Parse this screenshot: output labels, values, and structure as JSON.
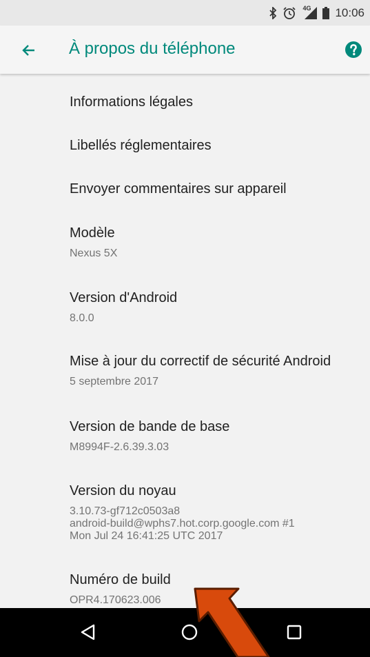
{
  "status_bar": {
    "network_label": "4G",
    "time": "10:06",
    "icons": [
      "bluetooth-icon",
      "alarm-icon",
      "signal-icon",
      "battery-icon"
    ]
  },
  "app_bar": {
    "title": "À propos du téléphone",
    "accent_color": "#00897b",
    "back_icon": "arrow-back-icon",
    "help_icon": "help-circle-icon"
  },
  "preferences": [
    {
      "title": "Informations légales"
    },
    {
      "title": "Libellés réglementaires"
    },
    {
      "title": "Envoyer commentaires sur appareil"
    },
    {
      "title": "Modèle",
      "summary": [
        "Nexus 5X"
      ]
    },
    {
      "title": "Version d'Android",
      "summary": [
        "8.0.0"
      ]
    },
    {
      "title": "Mise à jour du correctif de sécurité Android",
      "summary": [
        "5 septembre 2017"
      ]
    },
    {
      "title": "Version de bande de base",
      "summary": [
        "M8994F-2.6.39.3.03"
      ]
    },
    {
      "title": "Version du noyau",
      "summary": [
        "3.10.73-gf712c0503a8",
        "android-build@wphs7.hot.corp.google.com #1",
        "Mon Jul 24 16:41:25 UTC 2017"
      ]
    },
    {
      "title": "Numéro de build",
      "summary": [
        "OPR4.170623.006"
      ]
    }
  ],
  "nav_bar": {
    "icons": [
      "back-triangle-icon",
      "home-circle-icon",
      "recents-square-icon"
    ]
  },
  "annotation": {
    "arrow_color": "#d84a0c"
  }
}
